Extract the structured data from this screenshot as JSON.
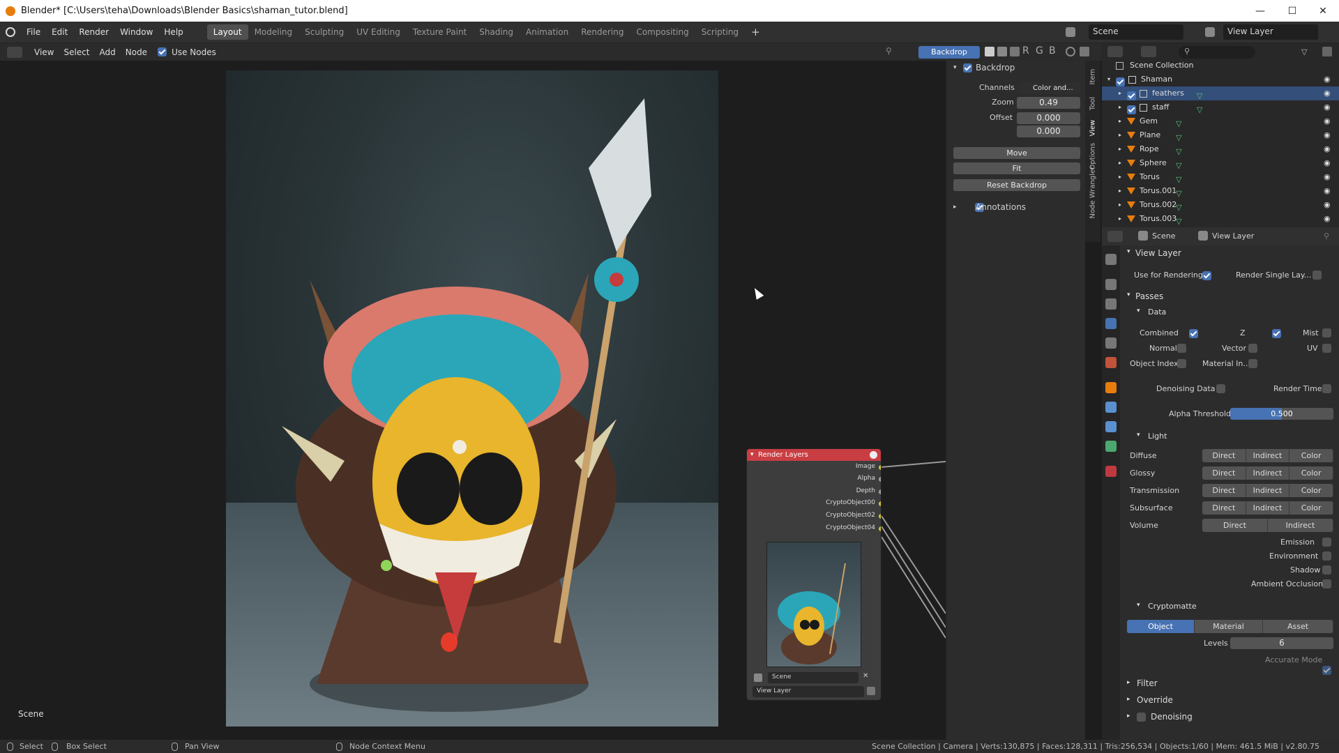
{
  "titlebar": {
    "title": "Blender* [C:\\Users\\teha\\Downloads\\Blender Basics\\shaman_tutor.blend]"
  },
  "menus": [
    "File",
    "Edit",
    "Render",
    "Window",
    "Help"
  ],
  "workspaces": [
    "Layout",
    "Modeling",
    "Sculpting",
    "UV Editing",
    "Texture Paint",
    "Shading",
    "Animation",
    "Rendering",
    "Compositing",
    "Scripting"
  ],
  "topbar": {
    "scene": "Scene",
    "view_layer": "View Layer"
  },
  "node_header": {
    "menus": [
      "View",
      "Select",
      "Add",
      "Node"
    ],
    "use_nodes": "Use Nodes",
    "backdrop_btn": "Backdrop",
    "channels": [
      "R",
      "G",
      "B"
    ]
  },
  "npanel": {
    "backdrop": "Backdrop",
    "channels_label": "Channels",
    "channels_value": "Color and...",
    "zoom_label": "Zoom",
    "zoom": "0.49",
    "offset_label": "Offset",
    "offset_x": "0.000",
    "offset_y": "0.000",
    "move": "Move",
    "fit": "Fit",
    "reset": "Reset Backdrop",
    "annotations": "Annotations",
    "tabs": [
      "Item",
      "Tool",
      "View",
      "Options",
      "Node Wrangler"
    ]
  },
  "node": {
    "title": "Render Layers",
    "sockets": [
      "Image",
      "Alpha",
      "Depth",
      "CryptoObject00",
      "CryptoObject02",
      "CryptoObject04"
    ],
    "scene": "Scene",
    "view_layer": "View Layer"
  },
  "editor_label": "Scene",
  "outliner": {
    "root": "Scene Collection",
    "items": [
      {
        "name": "Shaman",
        "level": 1
      },
      {
        "name": "feathers",
        "level": 2
      },
      {
        "name": "staff",
        "level": 2
      },
      {
        "name": "Gem",
        "level": 2
      },
      {
        "name": "Plane",
        "level": 2
      },
      {
        "name": "Rope",
        "level": 2
      },
      {
        "name": "Sphere",
        "level": 2
      },
      {
        "name": "Torus",
        "level": 2
      },
      {
        "name": "Torus.001",
        "level": 2
      },
      {
        "name": "Torus.002",
        "level": 2
      },
      {
        "name": "Torus.003",
        "level": 2
      }
    ]
  },
  "props": {
    "scene": "Scene",
    "view_layer": "View Layer",
    "view_layer_title": "View Layer",
    "use_for_rendering": "Use for Rendering",
    "render_single": "Render Single Lay...",
    "passes": "Passes",
    "data": "Data",
    "combined": "Combined",
    "z": "Z",
    "mist": "Mist",
    "normal": "Normal",
    "vector": "Vector",
    "uv": "UV",
    "object_index": "Object Index",
    "material_index": "Material In...",
    "denoising_data": "Denoising Data",
    "render_time": "Render Time",
    "alpha_threshold_label": "Alpha Threshold",
    "alpha_threshold": "0.500",
    "alpha_threshold_fraction": 0.5,
    "light": "Light",
    "light_rows": [
      {
        "label": "Diffuse",
        "buttons": [
          "Direct",
          "Indirect",
          "Color"
        ]
      },
      {
        "label": "Glossy",
        "buttons": [
          "Direct",
          "Indirect",
          "Color"
        ]
      },
      {
        "label": "Transmission",
        "buttons": [
          "Direct",
          "Indirect",
          "Color"
        ]
      },
      {
        "label": "Subsurface",
        "buttons": [
          "Direct",
          "Indirect",
          "Color"
        ]
      },
      {
        "label": "Volume",
        "buttons": [
          "Direct",
          "Indirect"
        ]
      }
    ],
    "emission": "Emission",
    "environment": "Environment",
    "shadow": "Shadow",
    "ao": "Ambient Occlusion",
    "cryptomatte": "Cryptomatte",
    "crypto_tabs": [
      "Object",
      "Material",
      "Asset"
    ],
    "levels_label": "Levels",
    "levels": "6",
    "accurate_mode": "Accurate Mode",
    "filter": "Filter",
    "override": "Override",
    "denoising": "Denoising"
  },
  "status": {
    "select": "Select",
    "box_select": "Box Select",
    "pan_view": "Pan View",
    "context_menu": "Node Context Menu",
    "info": "Scene Collection | Camera | Verts:130,875 | Faces:128,311 | Tris:256,534 | Objects:1/60 | Mem: 461.5 MiB | v2.80.75"
  }
}
